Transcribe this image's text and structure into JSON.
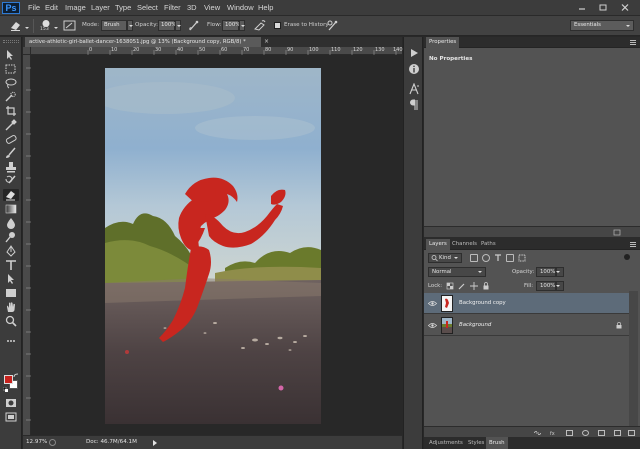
{
  "app": {
    "logo": "Ps",
    "menu": [
      "File",
      "Edit",
      "Image",
      "Layer",
      "Type",
      "Select",
      "Filter",
      "3D",
      "View",
      "Window",
      "Help"
    ],
    "window_controls": [
      "minimize",
      "restore",
      "close"
    ]
  },
  "options_bar": {
    "tool_icon": "eraser-icon",
    "brush_size": "153",
    "mode_label": "Mode:",
    "mode_value": "Brush",
    "opacity_label": "Opacity:",
    "opacity_value": "100%",
    "flow_label": "Flow:",
    "flow_value": "100%",
    "erase_to_history_label": "Erase to History",
    "erase_to_history_checked": false,
    "workspace": "Essentials"
  },
  "document": {
    "tab_title": "active-athletic-girl-ballet-dancer-1638051.jpg @ 13% (Background copy, RGB/8) *",
    "close_symbol": "×",
    "ruler_top_numbers": [
      "0",
      "10",
      "20",
      "30",
      "40",
      "50",
      "60",
      "70",
      "80",
      "90",
      "100",
      "110",
      "120",
      "130",
      "140"
    ],
    "zoom_level": "12.97%",
    "doc_size": "Doc: 46.7M/64.1M"
  },
  "colors": {
    "foreground": "#c8221d",
    "background": "#ffffff",
    "accent": "#5d6b79",
    "silhouette": "#c8261f"
  },
  "panels": {
    "properties_tab": "Properties",
    "no_properties": "No Properties",
    "layers_tabs": [
      "Layers",
      "Channels",
      "Paths"
    ],
    "filter_kind": "Kind",
    "blend_mode": "Normal",
    "opacity_label": "Opacity:",
    "opacity_value": "100%",
    "lock_label": "Lock:",
    "fill_label": "Fill:",
    "fill_value": "100%",
    "layers": [
      {
        "name": "Background copy",
        "selected": true,
        "italic": false,
        "locked": false
      },
      {
        "name": "Background",
        "selected": false,
        "italic": true,
        "locked": true
      }
    ],
    "bottom_tabs": [
      "Adjustments",
      "Styles",
      "Brush"
    ]
  }
}
